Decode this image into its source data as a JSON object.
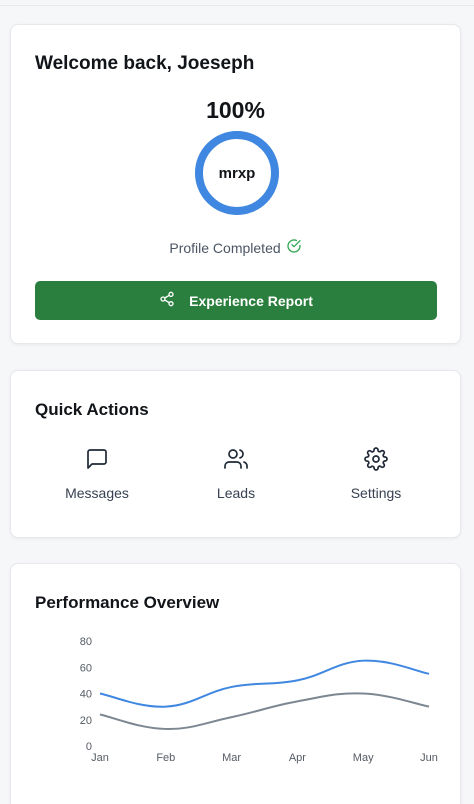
{
  "welcome": {
    "title": "Welcome back, Joeseph",
    "percent": "100%",
    "ring_label": "mrxp",
    "profile_status": "Profile Completed",
    "completion_fraction": 1.0,
    "ring_color": "#3f87e0",
    "check_color": "#34a853",
    "report_button": "Experience Report",
    "report_button_color": "#2b7f3e"
  },
  "quick_actions": {
    "title": "Quick Actions",
    "items": [
      {
        "label": "Messages",
        "icon": "message-square-icon"
      },
      {
        "label": "Leads",
        "icon": "users-icon"
      },
      {
        "label": "Settings",
        "icon": "gear-icon"
      }
    ]
  },
  "performance": {
    "title": "Performance Overview"
  },
  "chart_data": {
    "type": "line",
    "categories": [
      "Jan",
      "Feb",
      "Mar",
      "Apr",
      "May",
      "Jun"
    ],
    "series": [
      {
        "values": [
          40,
          30,
          45,
          50,
          65,
          55
        ],
        "color": "#3f87e0"
      },
      {
        "values": [
          24,
          13,
          22,
          34,
          40,
          30
        ],
        "color": "#7c8791"
      }
    ],
    "ylim": [
      0,
      80
    ],
    "yticks": [
      "80",
      "60",
      "40",
      "20",
      "0"
    ],
    "grid": false,
    "legend": "none"
  }
}
